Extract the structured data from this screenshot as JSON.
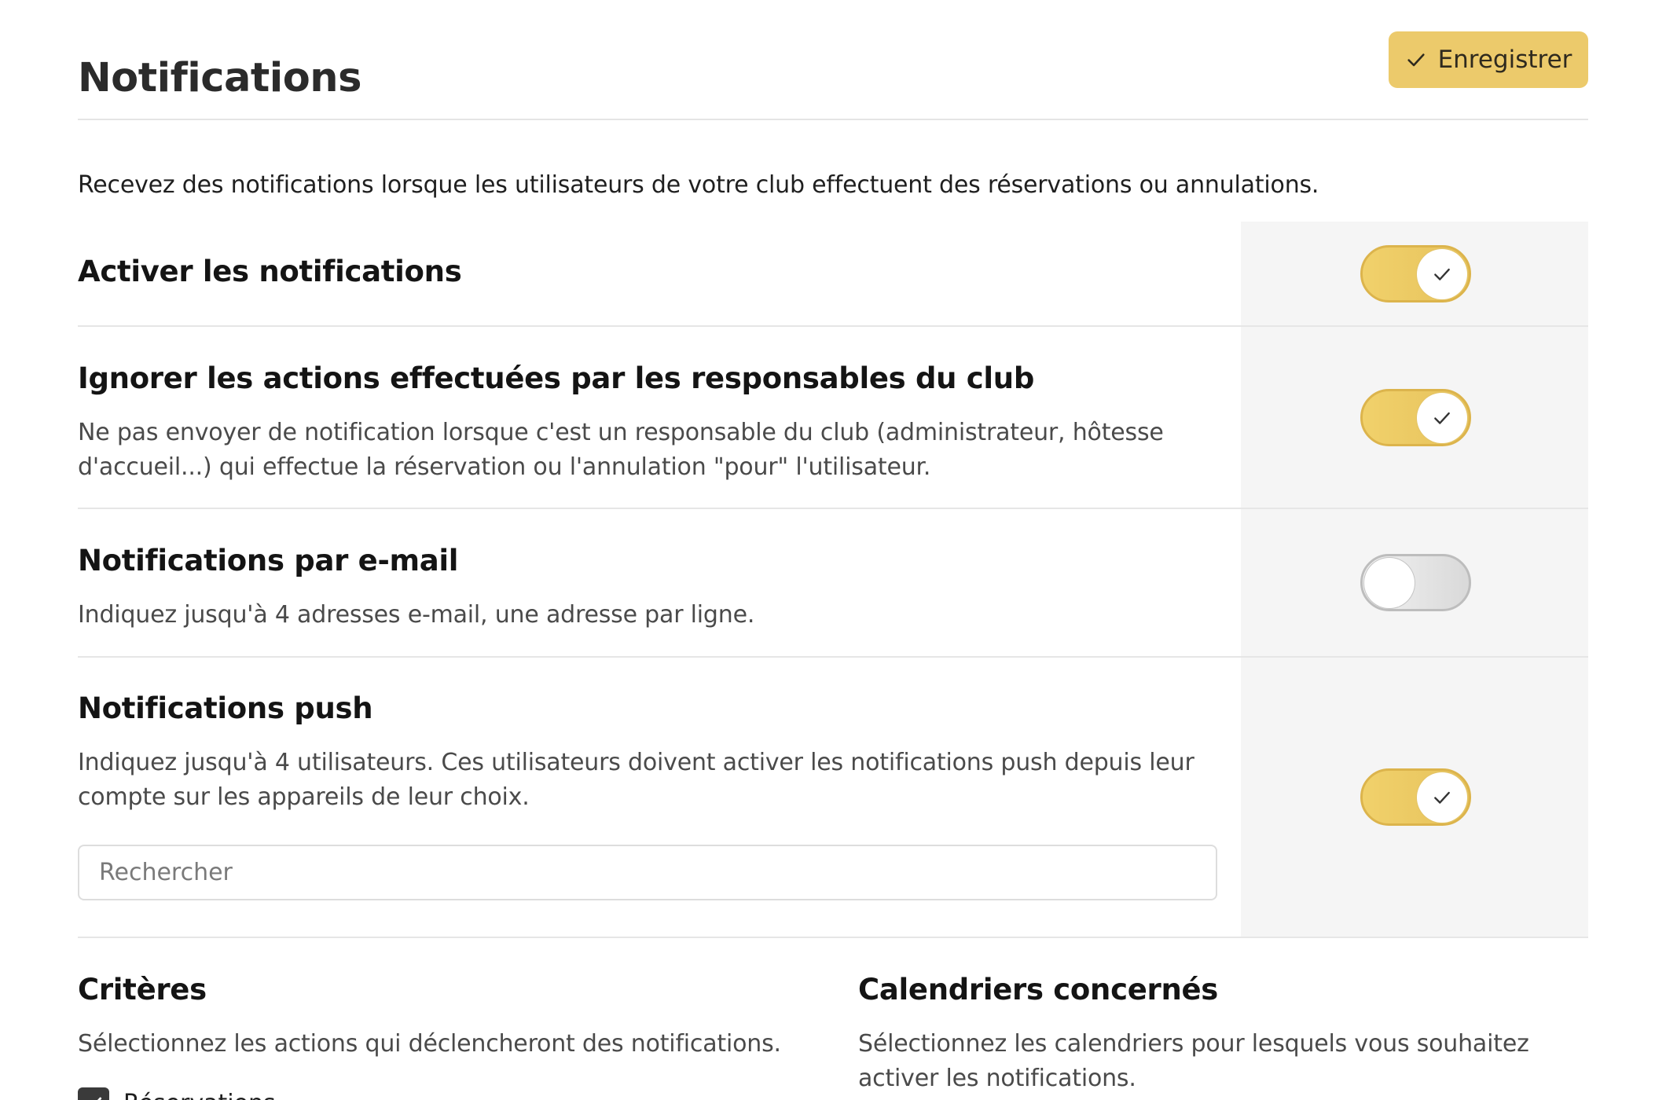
{
  "header": {
    "title": "Notifications",
    "save_label": "Enregistrer"
  },
  "intro": "Recevez des notifications lorsque les utilisateurs de votre club effectuent des réservations ou annulations.",
  "settings": [
    {
      "title": "Activer les notifications",
      "description": "",
      "enabled": true
    },
    {
      "title": "Ignorer les actions effectuées par les responsables du club",
      "description": "Ne pas envoyer de notification lorsque c'est un responsable du club (administrateur, hôtesse d'accueil...) qui effectue la réservation ou l'annulation \"pour\" l'utilisateur.",
      "enabled": true
    },
    {
      "title": "Notifications par e-mail",
      "description": "Indiquez jusqu'à 4 adresses e-mail, une adresse par ligne.",
      "enabled": false
    },
    {
      "title": "Notifications push",
      "description": "Indiquez jusqu'à 4 utilisateurs. Ces utilisateurs doivent activer les notifications push depuis leur compte sur les appareils de leur choix.",
      "enabled": true,
      "search_placeholder": "Rechercher"
    }
  ],
  "criteria": {
    "title": "Critères",
    "description": "Sélectionnez les actions qui déclencheront des notifications.",
    "first_option_label": "Réservations",
    "first_option_checked": true
  },
  "calendars": {
    "title": "Calendriers concernés",
    "description": "Sélectionnez les calendriers pour lesquels vous souhaitez activer les notifications."
  },
  "colors": {
    "accent": "#ecca6b",
    "toggle_on": "#e6c25c",
    "toggle_off": "#d9d9d9",
    "side_panel": "#f5f5f5"
  }
}
